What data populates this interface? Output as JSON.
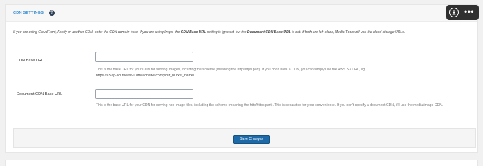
{
  "section": {
    "title": "CDN Settings",
    "help_icon": "?"
  },
  "overlay": {
    "download_icon": "download-circle-icon",
    "more_icon": "more-dots-icon",
    "more_glyph": "•••"
  },
  "intro": {
    "part1": "If you are using CloudFront, Fastly or another CDN, enter the CDN domain here. If you are using Imgix, the ",
    "bold1": "CDN Base URL",
    "part2": " setting is ignored, but the ",
    "bold2": "Document CDN Base URL",
    "part3": " is not. If both are left blank, Media Tools will use the cloud storage URLs."
  },
  "fields": [
    {
      "label": "CDN Base URL",
      "value": "",
      "description": "This is the base URL for your CDN for serving images, including the scheme (meaning the http/https part). If you don't have a CDN, you can simply use the AWS S3 URL, eg",
      "example": "https://s3-ap-southeast-1.amazonaws.com/your_bucket_name/."
    },
    {
      "label": "Document CDN Base URL",
      "value": "",
      "description": "This is the base URL for your CDN for serving non-image files, including the scheme (meaning the http/https part). This is separated for your convenience. If you don't specify a document CDN, it'll use the media/image CDN."
    }
  ],
  "actions": {
    "save_label": "Save Changes"
  },
  "colors": {
    "title": "#3a8fd0",
    "primary_button": "#1e6aa9",
    "help_icon_bg": "#2c3e55"
  }
}
